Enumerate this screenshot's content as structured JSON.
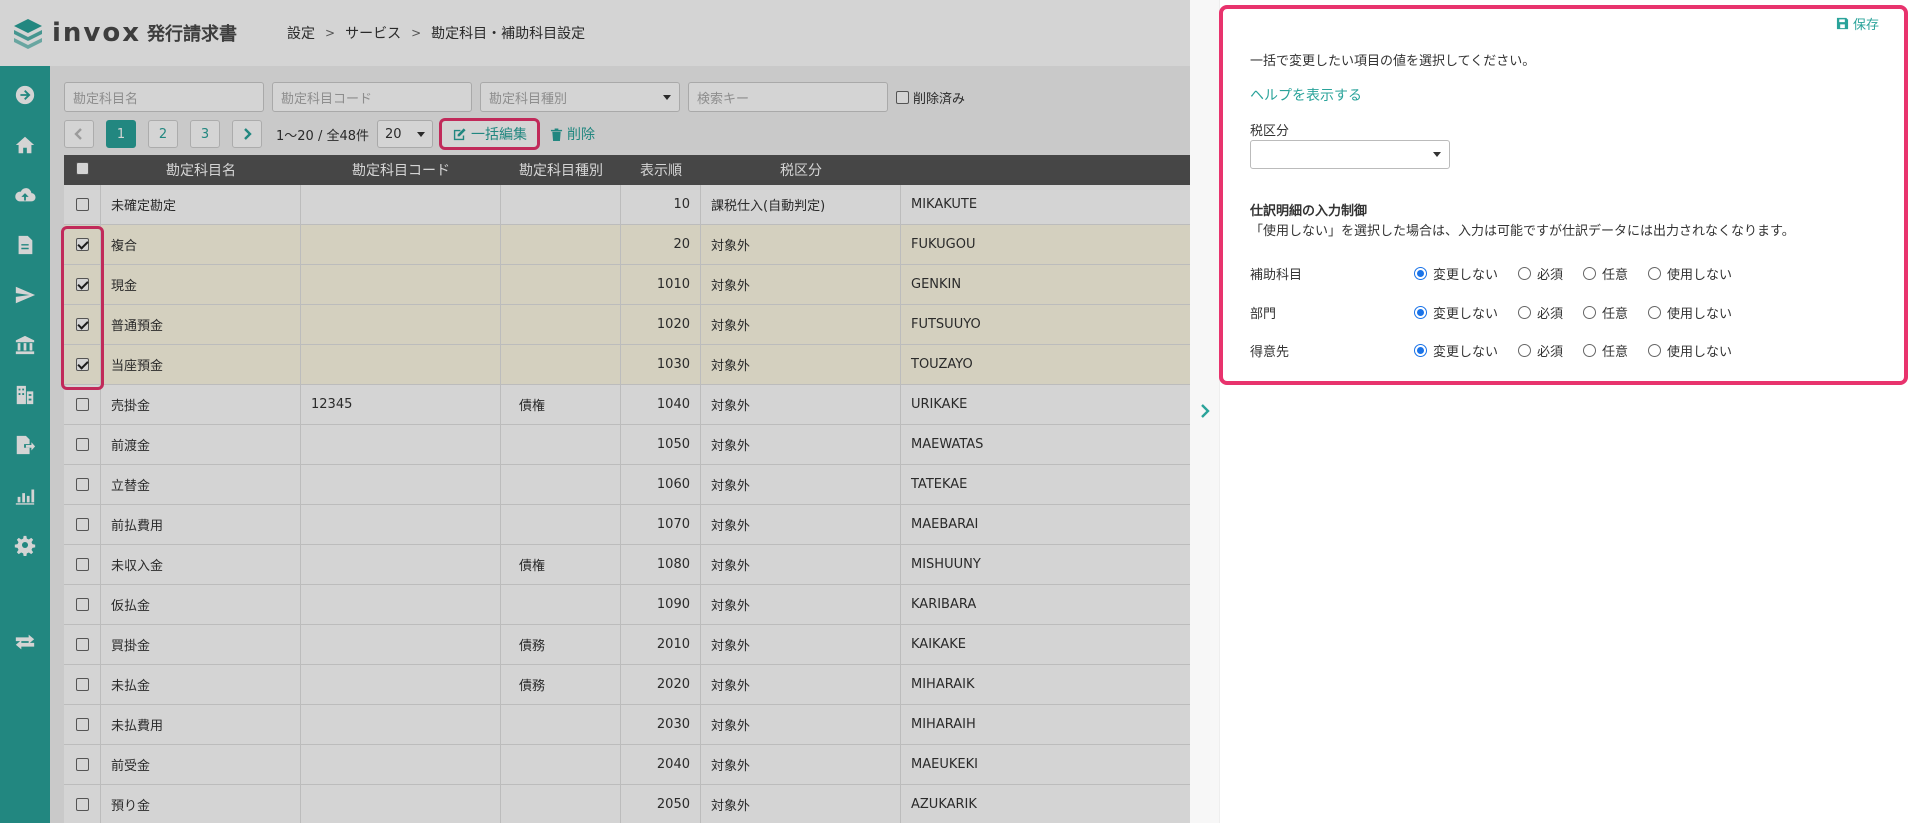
{
  "app": {
    "logo_text": "invox",
    "logo_sub": "発行請求書",
    "brand_color": "#2aa39a",
    "highlight_color": "#e8336d"
  },
  "breadcrumb": [
    "設定",
    "サービス",
    "勘定科目・補助科目設定"
  ],
  "sidebar": {
    "icons": [
      "arrow-right-circle-icon",
      "home-icon",
      "cloud-upload-icon",
      "document-icon",
      "send-icon",
      "bank-icon",
      "building-icon",
      "file-export-icon",
      "chart-icon",
      "gear-icon",
      "transfer-icon"
    ]
  },
  "filters": {
    "name_placeholder": "勘定科目名",
    "code_placeholder": "勘定科目コード",
    "type_placeholder": "勘定科目種別",
    "key_placeholder": "検索キー",
    "deleted_label": "削除済み"
  },
  "pager": {
    "pages": [
      "1",
      "2",
      "3"
    ],
    "current": "1",
    "count_text": "1〜20 / 全48件",
    "per_page": "20",
    "bulk_edit_label": "一括編集",
    "delete_label": "削除"
  },
  "table": {
    "headers": [
      "勘定科目名",
      "勘定科目コード",
      "勘定科目種別",
      "表示順",
      "税区分",
      ""
    ],
    "rows": [
      {
        "checked": false,
        "name": "未確定勘定",
        "code": "",
        "type": "",
        "order": "10",
        "tax": "課税仕入(自動判定)",
        "key": "MIKAKUTE"
      },
      {
        "checked": true,
        "name": "複合",
        "code": "",
        "type": "",
        "order": "20",
        "tax": "対象外",
        "key": "FUKUGOU"
      },
      {
        "checked": true,
        "name": "現金",
        "code": "",
        "type": "",
        "order": "1010",
        "tax": "対象外",
        "key": "GENKIN"
      },
      {
        "checked": true,
        "name": "普通預金",
        "code": "",
        "type": "",
        "order": "1020",
        "tax": "対象外",
        "key": "FUTSUUYO"
      },
      {
        "checked": true,
        "name": "当座預金",
        "code": "",
        "type": "",
        "order": "1030",
        "tax": "対象外",
        "key": "TOUZAYO"
      },
      {
        "checked": false,
        "name": "売掛金",
        "code": "12345",
        "type": "債権",
        "order": "1040",
        "tax": "対象外",
        "key": "URIKAKE"
      },
      {
        "checked": false,
        "name": "前渡金",
        "code": "",
        "type": "",
        "order": "1050",
        "tax": "対象外",
        "key": "MAEWATAS"
      },
      {
        "checked": false,
        "name": "立替金",
        "code": "",
        "type": "",
        "order": "1060",
        "tax": "対象外",
        "key": "TATEKAE"
      },
      {
        "checked": false,
        "name": "前払費用",
        "code": "",
        "type": "",
        "order": "1070",
        "tax": "対象外",
        "key": "MAEBARAI"
      },
      {
        "checked": false,
        "name": "未収入金",
        "code": "",
        "type": "債権",
        "order": "1080",
        "tax": "対象外",
        "key": "MISHUUNY"
      },
      {
        "checked": false,
        "name": "仮払金",
        "code": "",
        "type": "",
        "order": "1090",
        "tax": "対象外",
        "key": "KARIBARA"
      },
      {
        "checked": false,
        "name": "買掛金",
        "code": "",
        "type": "債務",
        "order": "2010",
        "tax": "対象外",
        "key": "KAIKAKE"
      },
      {
        "checked": false,
        "name": "未払金",
        "code": "",
        "type": "債務",
        "order": "2020",
        "tax": "対象外",
        "key": "MIHARAIK"
      },
      {
        "checked": false,
        "name": "未払費用",
        "code": "",
        "type": "",
        "order": "2030",
        "tax": "対象外",
        "key": "MIHARAIH"
      },
      {
        "checked": false,
        "name": "前受金",
        "code": "",
        "type": "",
        "order": "2040",
        "tax": "対象外",
        "key": "MAEUKEKI"
      },
      {
        "checked": false,
        "name": "預り金",
        "code": "",
        "type": "",
        "order": "2050",
        "tax": "対象外",
        "key": "AZUKARIK"
      }
    ]
  },
  "panel": {
    "save_label": "保存",
    "instruction": "一括で変更したい項目の値を選択してください。",
    "help_link": "ヘルプを表示する",
    "tax_label": "税区分",
    "tax_value": "",
    "control_title": "仕訳明細の入力制御",
    "control_note": "「使用しない」を選択した場合は、入力は可能ですが仕訳データには出力されなくなります。",
    "options": [
      "変更しない",
      "必須",
      "任意",
      "使用しない"
    ],
    "controls": [
      {
        "label": "補助科目",
        "selected": "変更しない"
      },
      {
        "label": "部門",
        "selected": "変更しない"
      },
      {
        "label": "得意先",
        "selected": "変更しない"
      }
    ]
  }
}
